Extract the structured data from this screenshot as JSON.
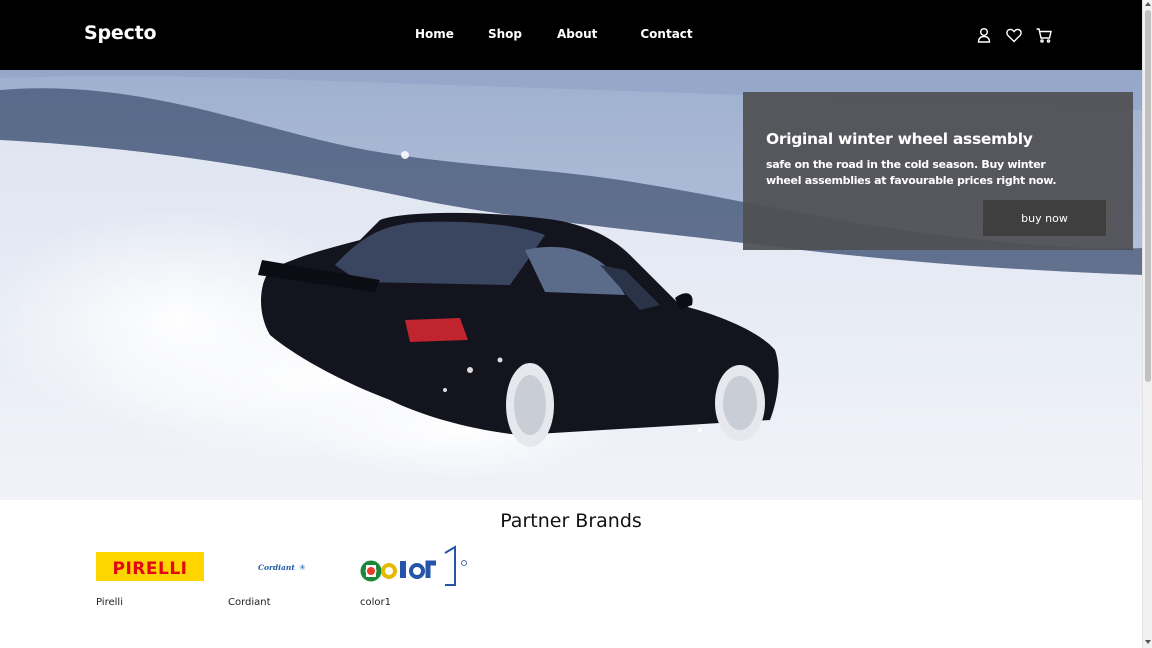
{
  "header": {
    "logo": "Specto",
    "nav": [
      "Home",
      "Shop",
      "About",
      "Contact"
    ],
    "icons": [
      "user-icon",
      "heart-icon",
      "cart-icon"
    ]
  },
  "hero": {
    "promo_title": "Original winter wheel assembly",
    "promo_subtitle": "safe on the road in the cold season. Buy winter wheel assemblies at favourable prices right now.",
    "button_label": "buy now"
  },
  "partners": {
    "title": "Partner Brands",
    "brands": [
      {
        "name": "Pirelli",
        "logo_text": "PIRELLI"
      },
      {
        "name": "Cordiant",
        "logo_text": "Cordiant"
      },
      {
        "name": "color1",
        "logo_text": "color"
      }
    ]
  },
  "colors": {
    "header_bg": "#000000",
    "promo_bg": "#505054",
    "pirelli_yellow": "#ffd500",
    "pirelli_red": "#e30613"
  }
}
